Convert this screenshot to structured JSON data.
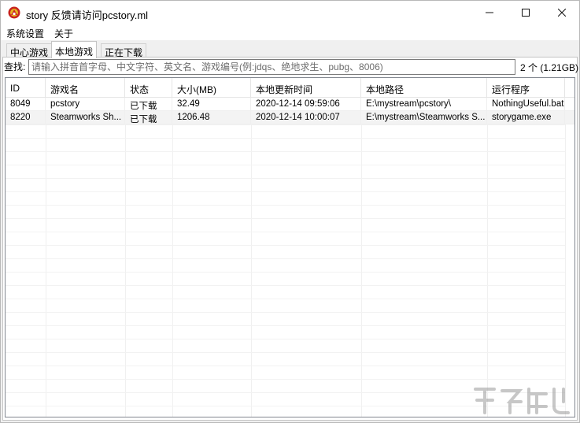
{
  "window": {
    "title": "story 反馈请访问pcstory.ml"
  },
  "menu": {
    "items": [
      {
        "label": "系统设置"
      },
      {
        "label": "关于"
      }
    ]
  },
  "tabs": [
    {
      "label": "中心游戏"
    },
    {
      "label": "本地游戏"
    },
    {
      "label": "正在下载"
    }
  ],
  "search": {
    "label": "查找:",
    "placeholder": "请输入拼音首字母、中文字符、英文名、游戏编号(例:jdqs、绝地求生、pubg、8006)",
    "value": ""
  },
  "count_text": "2 个 (1.21GB)",
  "table": {
    "columns": [
      "ID",
      "游戏名",
      "状态",
      "大小(MB)",
      "本地更新时间",
      "本地路径",
      "运行程序"
    ],
    "rows": [
      [
        "8049",
        "pcstory",
        "已下载",
        "32.49",
        "2020-12-14 09:59:06",
        "E:\\mystream\\pcstory\\",
        "NothingUseful.bat"
      ],
      [
        "8220",
        "Steamworks Sh...",
        "已下载",
        "1206.48",
        "2020-12-14 10:00:07",
        "E:\\mystream\\Steamworks S...",
        "storygame.exe"
      ]
    ]
  },
  "colors": {
    "close_accent": "#c42b1c",
    "grid_border": "#828790"
  }
}
